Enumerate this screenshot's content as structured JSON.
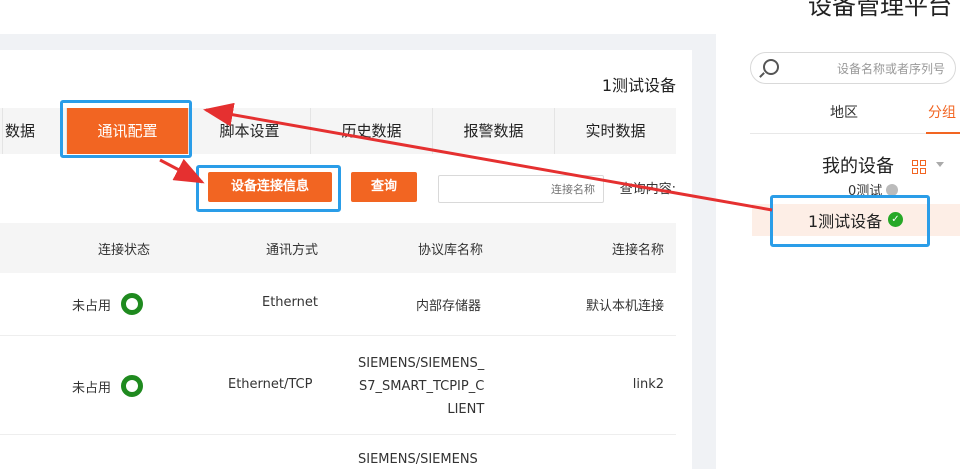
{
  "page": {
    "title": "设备管理平台"
  },
  "main": {
    "device_title": "1测试设备",
    "tabs": [
      {
        "label": "实时数据"
      },
      {
        "label": "报警数据"
      },
      {
        "label": "历史数据"
      },
      {
        "label": "脚本设置"
      },
      {
        "label": "通讯配置",
        "active": true
      },
      {
        "label": "数据"
      }
    ],
    "query": {
      "label": "查询内容:",
      "placeholder": "连接名称",
      "query_button": "查询",
      "connection_info_button": "设备连接信息"
    },
    "table": {
      "headers": [
        "连接名称",
        "协议库名称",
        "通讯方式",
        "连接状态"
      ],
      "rows": [
        {
          "name": "默认本机连接",
          "protocol": "内部存储器",
          "method": "Ethernet",
          "status": "未占用"
        },
        {
          "name": "link2",
          "protocol_lines": [
            "SIEMENS/SIEMENS_",
            "S7_SMART_TCPIP_C",
            "LIENT"
          ],
          "method": "Ethernet/TCP",
          "status": "未占用"
        },
        {
          "protocol_lines": [
            "SIEMENS/SIEMENS"
          ]
        }
      ]
    }
  },
  "sidebar": {
    "search_placeholder": "设备名称或者序列号",
    "tabs": [
      {
        "label": "分组",
        "active": true
      },
      {
        "label": "地区"
      }
    ],
    "tree_title": "我的设备",
    "items": [
      {
        "label": "0测试"
      },
      {
        "label": "1测试设备",
        "selected": true
      }
    ]
  },
  "colors": {
    "accent": "#f26522",
    "highlight": "#2a9de8",
    "arrow": "#e53030",
    "status_ok": "#1f8a1f"
  }
}
